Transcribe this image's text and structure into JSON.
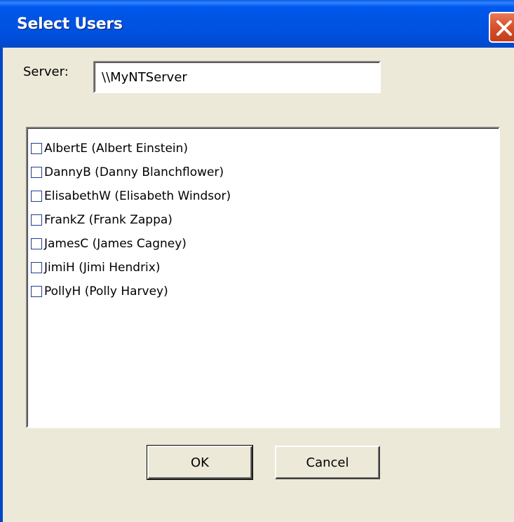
{
  "window": {
    "title": "Select Users",
    "close_icon": "close-icon"
  },
  "server": {
    "label": "Server:",
    "value": "\\\\MyNTServer"
  },
  "users": [
    {
      "label": "AlbertE (Albert Einstein)",
      "checked": false
    },
    {
      "label": "DannyB (Danny Blanchflower)",
      "checked": false
    },
    {
      "label": "ElisabethW (Elisabeth Windsor)",
      "checked": false
    },
    {
      "label": "FrankZ (Frank Zappa)",
      "checked": false
    },
    {
      "label": "JamesC (James Cagney)",
      "checked": false
    },
    {
      "label": "JimiH (Jimi Hendrix)",
      "checked": false
    },
    {
      "label": "PollyH (Polly Harvey)",
      "checked": false
    }
  ],
  "buttons": {
    "ok_label": "OK",
    "cancel_label": "Cancel"
  },
  "colors": {
    "titlebar": "#0054e3",
    "close_button": "#d9532f",
    "dialog_background": "#ece9d8"
  }
}
